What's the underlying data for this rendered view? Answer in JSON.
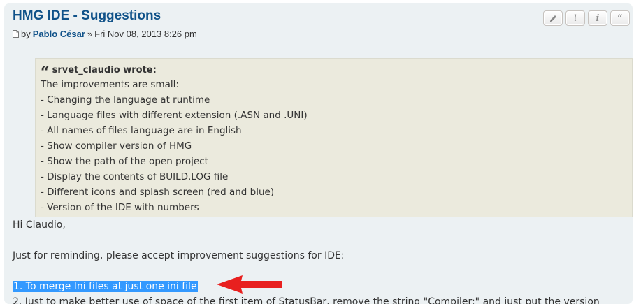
{
  "post": {
    "title": "HMG IDE - Suggestions",
    "by": "by",
    "author": "Pablo César",
    "separator": "»",
    "date": "Fri Nov 08, 2013 8:26 pm",
    "buttons": {
      "edit_icon": "pencil-icon",
      "report_label": "!",
      "info_label": "i",
      "quote_label": "“"
    }
  },
  "quote": {
    "author_label": "srvet_claudio wrote:",
    "lines": [
      "The improvements are small:",
      "- Changing the language at runtime",
      "- Language files with different extension (.ASN and .UNI)",
      "- All names of files language are in English",
      "- Show compiler version of HMG",
      "- Show the path of the open project",
      "- Display the contents of BUILD.LOG file",
      "- Different icons and splash screen (red and blue)",
      "- Version of the IDE with numbers"
    ]
  },
  "reply": {
    "greeting": "Hi Claudio,",
    "intro": "Just for reminding, please accept improvement suggestions for IDE:",
    "item1": "1. To merge Ini files at just one ini file",
    "item2": "2. Just to make better use of space of the first item of StatusBar, remove the string \"Compiler:\" and just put the version"
  },
  "colors": {
    "title": "#105289",
    "post_bg": "#ecf1f3",
    "quote_bg": "#ebeadd",
    "highlight": "#3399ff",
    "arrow": "#e8201f"
  }
}
